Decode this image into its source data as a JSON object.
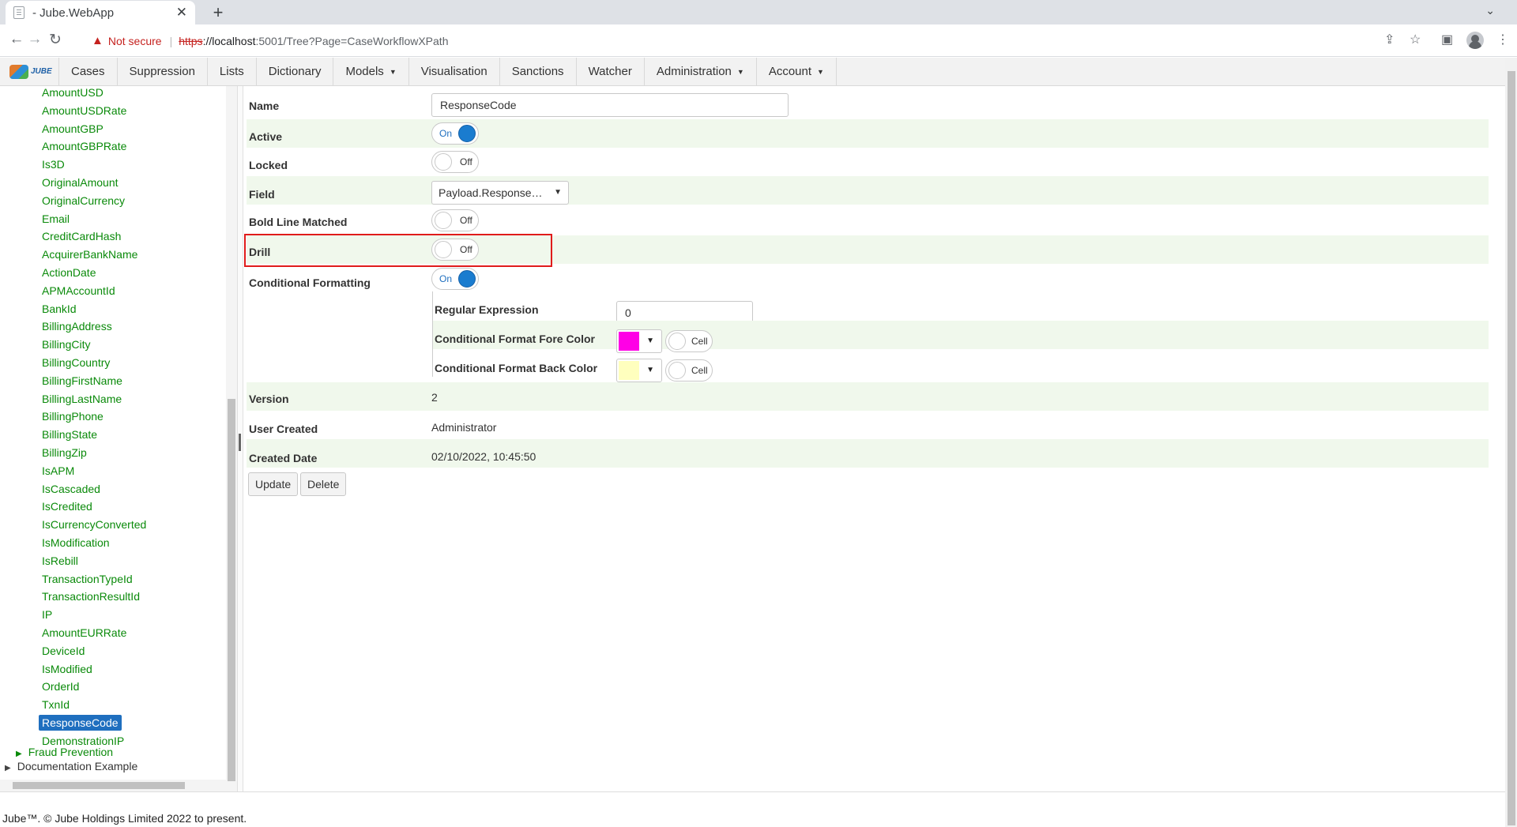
{
  "browser": {
    "tab_title": "- Jube.WebApp",
    "new_tab": "+",
    "not_secure": "Not secure",
    "url_scheme": "https",
    "url_host": "://localhost",
    "url_rest": ":5001/Tree?Page=CaseWorkflowXPath"
  },
  "app": {
    "logo_text": "JUBE",
    "menu": [
      {
        "label": "Cases"
      },
      {
        "label": "Suppression"
      },
      {
        "label": "Lists"
      },
      {
        "label": "Dictionary"
      },
      {
        "label": "Models",
        "dropdown": true
      },
      {
        "label": "Visualisation"
      },
      {
        "label": "Sanctions"
      },
      {
        "label": "Watcher"
      },
      {
        "label": "Administration",
        "dropdown": true
      },
      {
        "label": "Account",
        "dropdown": true
      }
    ]
  },
  "tree": {
    "items": [
      "AmountUSD",
      "AmountUSDRate",
      "AmountGBP",
      "AmountGBPRate",
      "Is3D",
      "OriginalAmount",
      "OriginalCurrency",
      "Email",
      "CreditCardHash",
      "AcquirerBankName",
      "ActionDate",
      "APMAccountId",
      "BankId",
      "BillingAddress",
      "BillingCity",
      "BillingCountry",
      "BillingFirstName",
      "BillingLastName",
      "BillingPhone",
      "BillingState",
      "BillingZip",
      "IsAPM",
      "IsCascaded",
      "IsCredited",
      "IsCurrencyConverted",
      "IsModification",
      "IsRebill",
      "TransactionTypeId",
      "TransactionResultId",
      "IP",
      "AmountEURRate",
      "DeviceId",
      "IsModified",
      "OrderId",
      "TxnId",
      "ResponseCode",
      "DemonstrationIP"
    ],
    "selected": "ResponseCode",
    "fraud_prevention": "Fraud Prevention",
    "documentation_example": "Documentation Example"
  },
  "form": {
    "name_label": "Name",
    "name_value": "ResponseCode",
    "active_label": "Active",
    "active_state": "On",
    "locked_label": "Locked",
    "locked_state": "Off",
    "field_label": "Field",
    "field_value": "Payload.Response…",
    "bold_label": "Bold Line Matched",
    "bold_state": "Off",
    "drill_label": "Drill",
    "drill_state": "Off",
    "cf_label": "Conditional Formatting",
    "cf_state": "On",
    "regex_label": "Regular Expression",
    "regex_value": "0",
    "fore_label": "Conditional Format Fore Color",
    "fore_color": "#ff00e6",
    "fore_cell": "Cell",
    "back_label": "Conditional Format Back Color",
    "back_color": "#ffffbe",
    "back_cell": "Cell",
    "version_label": "Version",
    "version_value": "2",
    "user_label": "User Created",
    "user_value": "Administrator",
    "date_label": "Created Date",
    "date_value": "02/10/2022, 10:45:50",
    "update_button": "Update",
    "delete_button": "Delete"
  },
  "footer": "Jube™. © Jube Holdings Limited 2022 to present."
}
